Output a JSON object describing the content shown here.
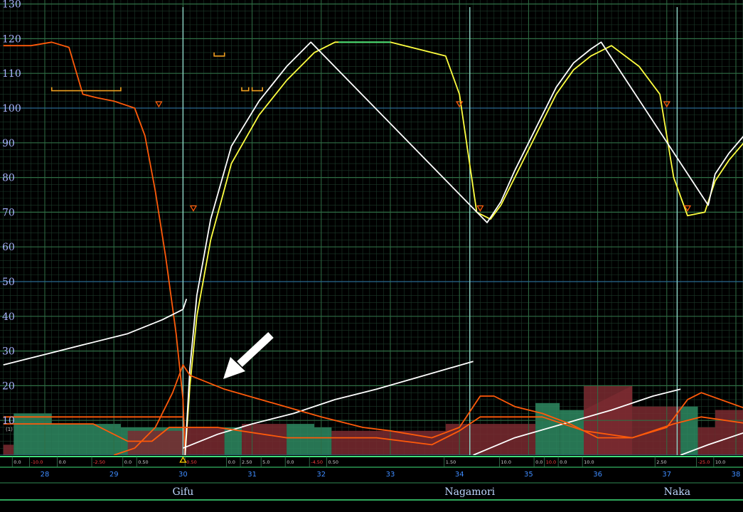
{
  "chart_data": {
    "type": "line",
    "x_axis": {
      "min": 27.4,
      "max": 38.2,
      "ticks": [
        "28",
        "29",
        "30",
        "31",
        "32",
        "33",
        "34",
        "35",
        "36",
        "37",
        "38"
      ]
    },
    "y_axis": {
      "min": 0,
      "max": 130,
      "ticks": [
        "130",
        "120",
        "110",
        "100",
        "90",
        "80",
        "70",
        "60",
        "50",
        "40",
        "30",
        "20",
        "10"
      ]
    },
    "grid": true,
    "stations": [
      {
        "name": "Gifu",
        "x": 30.0
      },
      {
        "name": "Nagamori",
        "x": 34.15
      },
      {
        "name": "Naka",
        "x": 37.15
      }
    ],
    "series": [
      {
        "color": "#ff5a0a",
        "points": [
          [
            27.4,
            118
          ],
          [
            27.8,
            118
          ],
          [
            28.1,
            119
          ],
          [
            28.35,
            117.5
          ],
          [
            28.55,
            104
          ],
          [
            28.75,
            103
          ],
          [
            29.0,
            102
          ],
          [
            29.3,
            100
          ],
          [
            29.45,
            92
          ],
          [
            29.6,
            76
          ],
          [
            29.75,
            57
          ],
          [
            29.9,
            35
          ],
          [
            30.0,
            16
          ],
          [
            30.03,
            0
          ]
        ]
      },
      {
        "color": "#ffff40",
        "points": [
          [
            30.03,
            0
          ],
          [
            30.1,
            20
          ],
          [
            30.2,
            40
          ],
          [
            30.4,
            62
          ],
          [
            30.7,
            84
          ],
          [
            31.1,
            98
          ],
          [
            31.5,
            108
          ],
          [
            31.9,
            116
          ],
          [
            32.2,
            119
          ],
          [
            33.0,
            119
          ],
          [
            33.8,
            115
          ],
          [
            34.0,
            104
          ],
          [
            34.25,
            70
          ],
          [
            34.45,
            68
          ],
          [
            34.6,
            72
          ],
          [
            34.8,
            80
          ],
          [
            35.0,
            88
          ],
          [
            35.2,
            96
          ],
          [
            35.4,
            104
          ],
          [
            35.65,
            111
          ],
          [
            35.9,
            115
          ],
          [
            36.2,
            118
          ],
          [
            36.6,
            112
          ],
          [
            36.9,
            104
          ],
          [
            37.1,
            80
          ],
          [
            37.3,
            69
          ],
          [
            37.55,
            70
          ],
          [
            37.7,
            79
          ],
          [
            37.9,
            85
          ],
          [
            38.2,
            92
          ]
        ]
      },
      {
        "color": "#ffffff",
        "points": [
          [
            30.03,
            0
          ],
          [
            30.1,
            25
          ],
          [
            30.2,
            46
          ],
          [
            30.4,
            68
          ],
          [
            30.7,
            89
          ],
          [
            31.1,
            102
          ],
          [
            31.5,
            112
          ],
          [
            31.85,
            119
          ],
          [
            34.4,
            67
          ],
          [
            34.6,
            73
          ],
          [
            34.8,
            82
          ],
          [
            35.0,
            90
          ],
          [
            35.2,
            98
          ],
          [
            35.4,
            106
          ],
          [
            35.65,
            113
          ],
          [
            35.9,
            117
          ],
          [
            36.05,
            119
          ],
          [
            37.6,
            72
          ],
          [
            37.7,
            81
          ],
          [
            37.9,
            87
          ],
          [
            38.2,
            94
          ]
        ]
      },
      {
        "color": "#3fe07a",
        "points": [
          [
            32.25,
            119
          ],
          [
            33.0,
            119
          ]
        ]
      },
      {
        "color": "#ffffff",
        "points": [
          [
            27.4,
            26
          ],
          [
            28.0,
            29
          ],
          [
            28.6,
            32
          ],
          [
            29.2,
            35
          ],
          [
            29.7,
            39
          ],
          [
            30.0,
            42
          ],
          [
            30.05,
            45
          ]
        ]
      },
      {
        "color": "#ffffff",
        "points": [
          [
            30.0,
            2
          ],
          [
            30.5,
            6
          ],
          [
            31.0,
            9
          ],
          [
            31.6,
            12
          ],
          [
            32.2,
            16
          ],
          [
            32.8,
            19
          ],
          [
            33.5,
            23
          ],
          [
            34.2,
            27
          ]
        ]
      },
      {
        "color": "#ffffff",
        "points": [
          [
            34.2,
            0
          ],
          [
            34.8,
            5
          ],
          [
            35.5,
            9
          ],
          [
            36.2,
            13
          ],
          [
            36.8,
            17
          ],
          [
            37.2,
            19
          ]
        ]
      },
      {
        "color": "#ffffff",
        "points": [
          [
            37.2,
            0
          ],
          [
            37.6,
            3
          ],
          [
            38.2,
            7
          ]
        ]
      },
      {
        "color": "#ff5a0a",
        "points": [
          [
            29.0,
            0
          ],
          [
            29.3,
            2
          ],
          [
            29.6,
            8
          ],
          [
            29.85,
            18
          ],
          [
            30.0,
            26
          ],
          [
            30.1,
            23
          ],
          [
            30.6,
            19
          ],
          [
            31.3,
            15
          ],
          [
            32.0,
            11
          ],
          [
            32.6,
            8
          ],
          [
            33.0,
            7
          ],
          [
            33.6,
            5
          ],
          [
            34.0,
            8
          ],
          [
            34.3,
            17
          ],
          [
            34.5,
            17
          ],
          [
            34.8,
            14
          ],
          [
            35.2,
            12
          ],
          [
            35.6,
            9
          ],
          [
            36.0,
            5
          ],
          [
            36.5,
            5
          ],
          [
            37.0,
            8
          ],
          [
            37.3,
            16
          ],
          [
            37.5,
            18
          ],
          [
            38.2,
            13
          ]
        ]
      },
      {
        "color": "#ff5a0a",
        "points": [
          [
            27.4,
            9
          ],
          [
            28.7,
            9
          ],
          [
            29.2,
            4
          ],
          [
            29.55,
            4
          ],
          [
            29.8,
            8
          ],
          [
            30.5,
            8
          ],
          [
            31.5,
            5
          ],
          [
            32.8,
            5
          ],
          [
            33.6,
            3
          ],
          [
            34.0,
            7
          ],
          [
            34.3,
            11
          ],
          [
            35.2,
            11
          ],
          [
            35.8,
            7
          ],
          [
            36.5,
            5
          ],
          [
            37.1,
            9
          ],
          [
            37.5,
            11
          ],
          [
            38.2,
            9
          ]
        ]
      },
      {
        "color": "#ff5a0a",
        "points": [
          [
            27.4,
            11
          ],
          [
            30.0,
            11
          ]
        ]
      }
    ],
    "speed_limit_bars": [
      [
        28.1,
        29.1,
        105
      ],
      [
        30.45,
        30.6,
        115
      ],
      [
        30.85,
        30.95,
        105
      ],
      [
        31.0,
        31.15,
        105
      ]
    ],
    "markers": [
      [
        29.65,
        101
      ],
      [
        30.15,
        71
      ],
      [
        34.0,
        101
      ],
      [
        34.3,
        71
      ],
      [
        37.0,
        101
      ],
      [
        37.3,
        71
      ]
    ],
    "gradient_labels": [
      {
        "x": 27.55,
        "t": "0.0",
        "c": "#d0d0d0"
      },
      {
        "x": 27.8,
        "t": "-10.0",
        "c": "#ff4040"
      },
      {
        "x": 28.2,
        "t": "0.0",
        "c": "#d0d0d0"
      },
      {
        "x": 28.7,
        "t": "-2.50",
        "c": "#ff4040"
      },
      {
        "x": 29.15,
        "t": "0.0",
        "c": "#d0d0d0"
      },
      {
        "x": 29.35,
        "t": "0.50",
        "c": "#d0d0d0"
      },
      {
        "x": 30.05,
        "t": "0.50",
        "c": "#ff4040"
      },
      {
        "x": 30.65,
        "t": "0.0",
        "c": "#d0d0d0"
      },
      {
        "x": 30.85,
        "t": "2.50",
        "c": "#d0d0d0"
      },
      {
        "x": 31.15,
        "t": "5.0",
        "c": "#d0d0d0"
      },
      {
        "x": 31.5,
        "t": "0.0",
        "c": "#d0d0d0"
      },
      {
        "x": 31.85,
        "t": "-4.50",
        "c": "#ff4040"
      },
      {
        "x": 32.1,
        "t": "0.50",
        "c": "#d0d0d0"
      },
      {
        "x": 33.8,
        "t": "1.50",
        "c": "#d0d0d0"
      },
      {
        "x": 34.6,
        "t": "10.0",
        "c": "#d0d0d0"
      },
      {
        "x": 35.1,
        "t": "0.0",
        "c": "#d0d0d0"
      },
      {
        "x": 35.25,
        "t": "10.0",
        "c": "#ff4040"
      },
      {
        "x": 35.45,
        "t": "0.0",
        "c": "#d0d0d0"
      },
      {
        "x": 35.8,
        "t": "10.0",
        "c": "#d0d0d0"
      },
      {
        "x": 36.85,
        "t": "2.50",
        "c": "#d0d0d0"
      },
      {
        "x": 37.45,
        "t": "-25.0",
        "c": "#ff4040"
      },
      {
        "x": 37.7,
        "t": "10.0",
        "c": "#d0d0d0"
      }
    ],
    "small_label": "(1)"
  }
}
